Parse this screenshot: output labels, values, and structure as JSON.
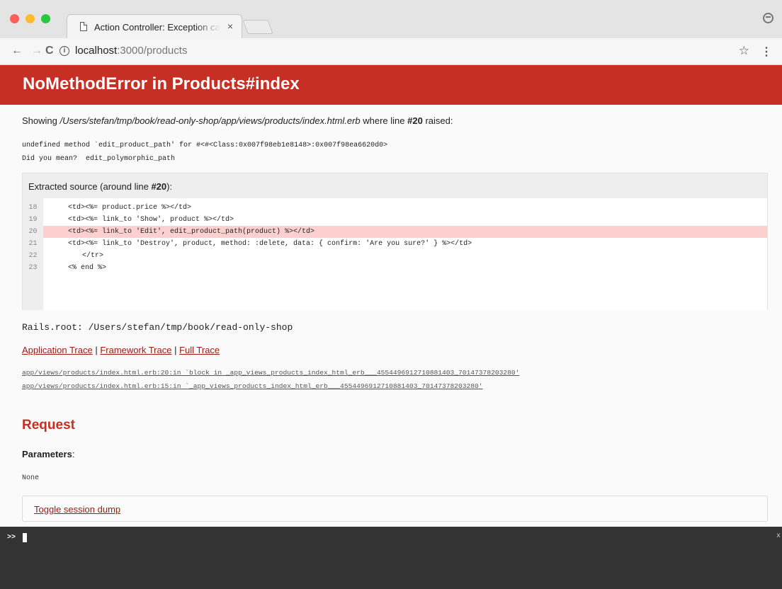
{
  "browser": {
    "tab_title": "Action Controller: Exception ca",
    "tab_close": "×",
    "url_host": "localhost",
    "url_rest": ":3000/products",
    "back_icon": "←",
    "forward_icon": "→",
    "reload_icon": "C",
    "info_icon": "i",
    "star_icon": "☆",
    "menu_icon": "⋮"
  },
  "error": {
    "title": "NoMethodError in Products#index",
    "showing_prefix": "Showing ",
    "template_path": "/Users/stefan/tmp/book/read-only-shop/app/views/products/index.html.erb",
    "showing_middle": " where line ",
    "line_ref": "#20",
    "showing_suffix": " raised:",
    "message_line1": "undefined method `edit_product_path' for #<#<Class:0x007f98eb1e8148>:0x007f98ea6620d0>",
    "message_line2": "Did you mean?  edit_polymorphic_path"
  },
  "source": {
    "caption_prefix": "Extracted source (around line ",
    "caption_line": "#20",
    "caption_suffix": "):",
    "lines": [
      {
        "num": "18",
        "code": "<td><%= product.price %></td>"
      },
      {
        "num": "19",
        "code": "<td><%= link_to 'Show', product %></td>"
      },
      {
        "num": "20",
        "code": "<td><%= link_to 'Edit', edit_product_path(product) %></td>"
      },
      {
        "num": "21",
        "code": "<td><%= link_to 'Destroy', product, method: :delete, data: { confirm: 'Are you sure?' } %></td>"
      },
      {
        "num": "22",
        "code": "  </tr>"
      },
      {
        "num": "23",
        "code": "<% end %>"
      }
    ]
  },
  "rails_root": "Rails.root: /Users/stefan/tmp/book/read-only-shop",
  "trace_links": {
    "application": "Application Trace",
    "framework": "Framework Trace",
    "full": "Full Trace",
    "separator": " | "
  },
  "traces": [
    "app/views/products/index.html.erb:20:in `block in _app_views_products_index_html_erb___4554496912710881403_70147378203280'",
    "app/views/products/index.html.erb:15:in `_app_views_products_index_html_erb___4554496912710881403_70147378203280'"
  ],
  "request": {
    "heading": "Request",
    "params_label": "Parameters",
    "params_colon": ":",
    "params_value": "None",
    "toggle_session": "Toggle session dump"
  },
  "console": {
    "prompt": ">>",
    "close": "x"
  },
  "colors": {
    "header_red": "#c52f24",
    "highlight": "#fdd0d0",
    "link": "#9b1a12",
    "console_bg": "#333333"
  }
}
